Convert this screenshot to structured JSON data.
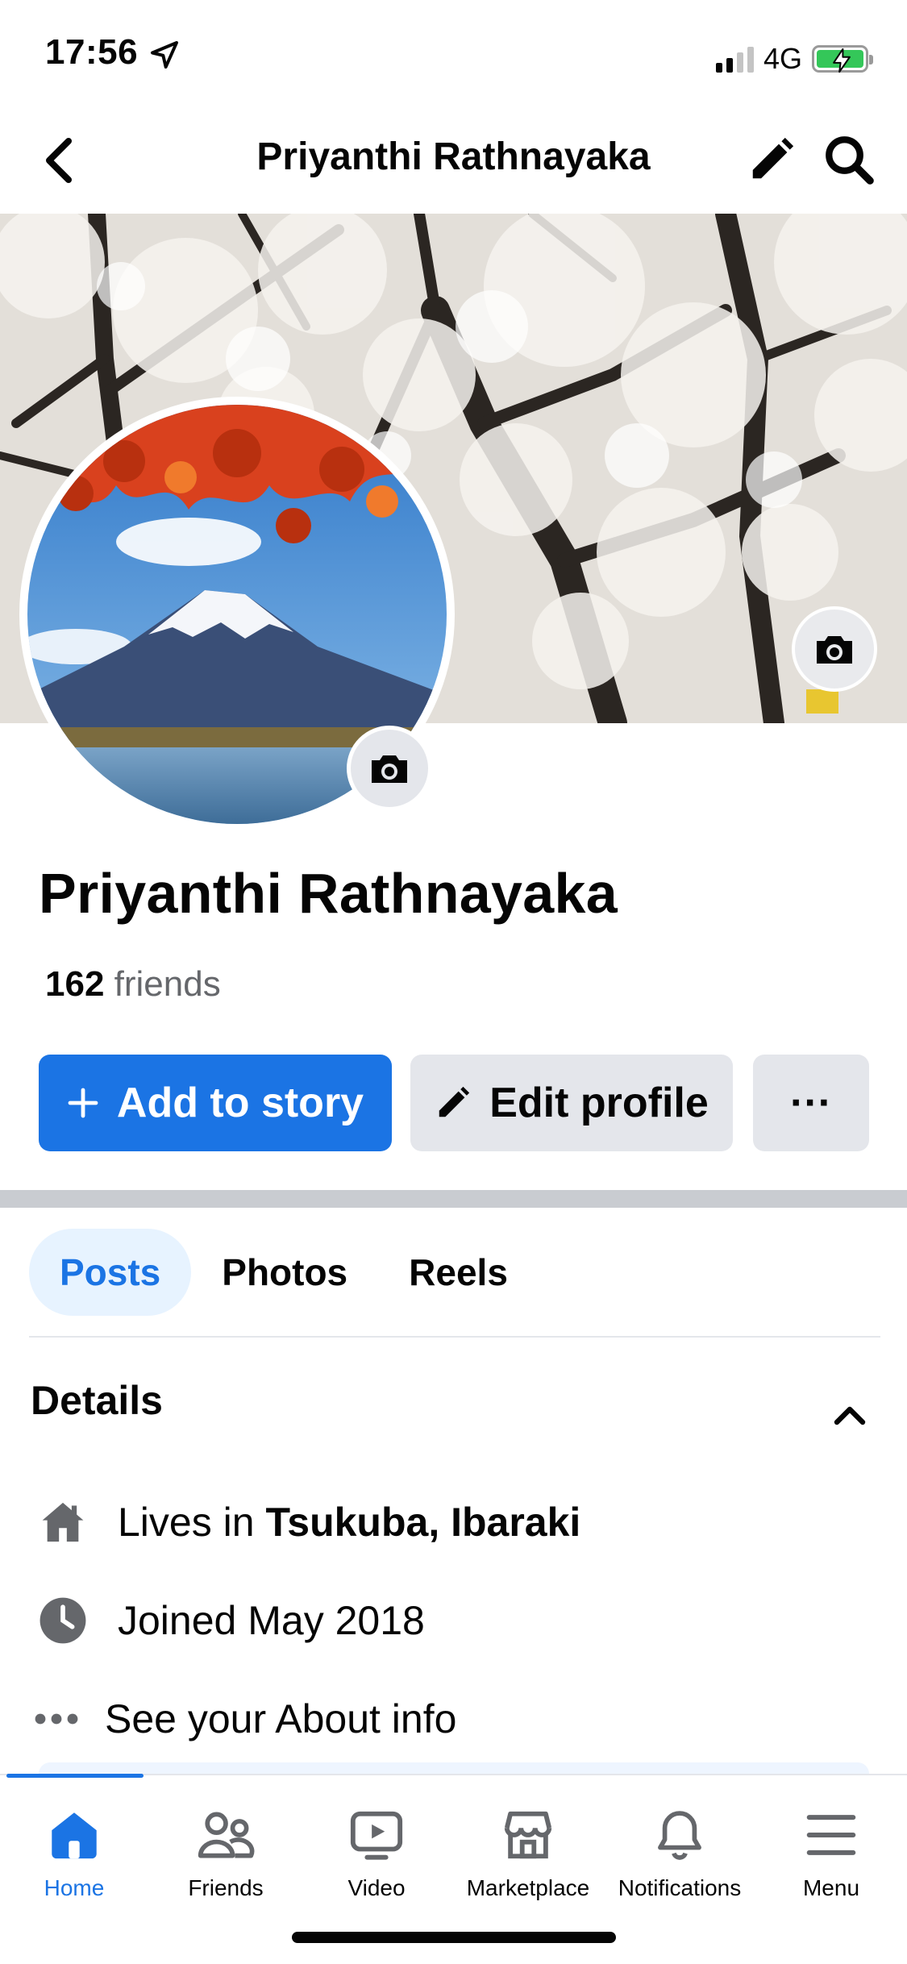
{
  "status_bar": {
    "time": "17:56",
    "network": "4G"
  },
  "header": {
    "title": "Priyanthi Rathnayaka"
  },
  "profile": {
    "name": "Priyanthi Rathnayaka",
    "friends_count": "162",
    "friends_label": "friends"
  },
  "actions": {
    "add_story": "Add to story",
    "edit_profile": "Edit profile",
    "more": "···"
  },
  "tabs": [
    {
      "label": "Posts",
      "active": true
    },
    {
      "label": "Photos",
      "active": false
    },
    {
      "label": "Reels",
      "active": false
    }
  ],
  "details": {
    "title": "Details",
    "lives_prefix": "Lives in",
    "lives_place": "Tsukuba, Ibaraki",
    "joined": "Joined May 2018",
    "about": "See your About info"
  },
  "bottom_nav": [
    {
      "label": "Home",
      "icon": "home-icon",
      "active": true
    },
    {
      "label": "Friends",
      "icon": "friends-icon",
      "active": false
    },
    {
      "label": "Video",
      "icon": "video-icon",
      "active": false
    },
    {
      "label": "Marketplace",
      "icon": "marketplace-icon",
      "active": false
    },
    {
      "label": "Notifications",
      "icon": "bell-icon",
      "active": false
    },
    {
      "label": "Menu",
      "icon": "menu-icon",
      "active": false
    }
  ],
  "colors": {
    "accent": "#1b74e4",
    "tab_active_bg": "#e7f3ff",
    "button_gray": "#e4e6eb",
    "battery": "#34c759"
  }
}
